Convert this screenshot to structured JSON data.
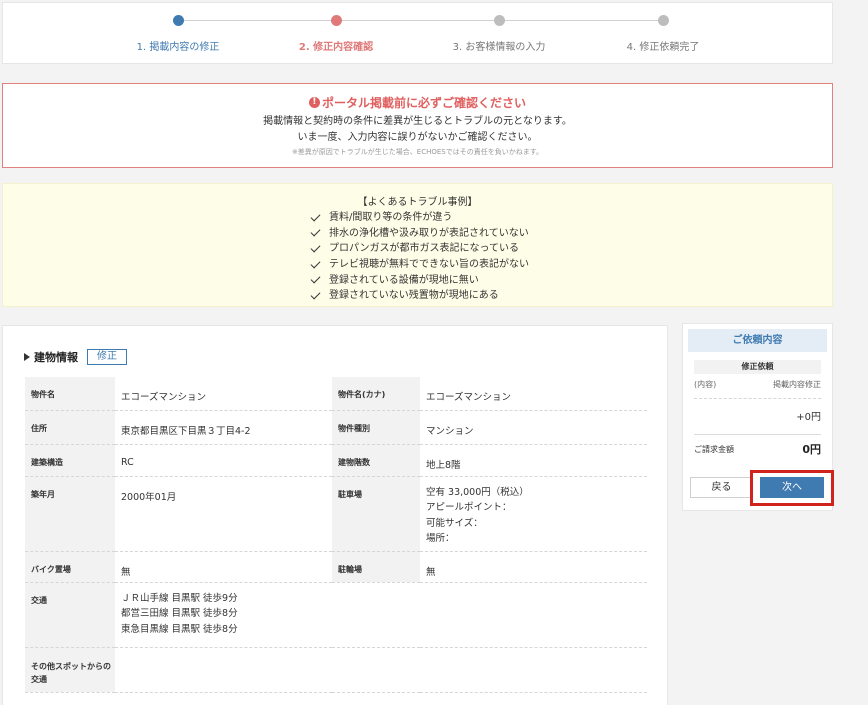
{
  "steps": [
    {
      "label": "1. 掲載内容の修正",
      "state": "done"
    },
    {
      "label": "2. 修正内容確認",
      "state": "active"
    },
    {
      "label": "3. お客様情報の入力",
      "state": "todo"
    },
    {
      "label": "4. 修正依頼完了",
      "state": "todo"
    }
  ],
  "alert": {
    "icon": "!",
    "title": "ポータル掲載前に必ずご確認ください",
    "line1": "掲載情報と契約時の条件に差異が生じるとトラブルの元となります。",
    "line2": "いま一度、入力内容に誤りがないかご確認ください。",
    "note": "※差異が原因でトラブルが生じた場合、ECHOESではその責任を負いかねます。"
  },
  "trouble": {
    "heading": "【よくあるトラブル事例】",
    "items": [
      "賃料/間取り等の条件が違う",
      "排水の浄化槽や汲み取りが表記されていない",
      "プロパンガスが都市ガス表記になっている",
      "テレビ視聴が無料でできない旨の表記がない",
      "登録されている設備が現地に無い",
      "登録されていない残置物が現地にある"
    ]
  },
  "building": {
    "title": "建物情報",
    "edit_label": "修正",
    "rows": {
      "name_label": "物件名",
      "name_value": "エコーズマンション",
      "kana_label": "物件名(カナ)",
      "kana_value": "エコーズマンション",
      "address_label": "住所",
      "address_value": "東京都目黒区下目黒３丁目4-2",
      "type_label": "物件種別",
      "type_value": "マンション",
      "structure_label": "建築構造",
      "structure_value": "RC",
      "floors_label": "建物階数",
      "floors_value": "地上8階",
      "built_label": "築年月",
      "built_value": "2000年01月",
      "parking_label": "駐車場",
      "parking_lines": [
        "空有 33,000円（税込）",
        "アピールポイント：",
        "可能サイズ：",
        "場所："
      ],
      "bike_label": "バイク置場",
      "bike_value": "無",
      "bicycle_label": "駐輪場",
      "bicycle_value": "無",
      "transport_label": "交通",
      "transport_lines": [
        "ＪＲ山手線 目黒駅 徒歩9分",
        "都営三田線 目黒駅 徒歩8分",
        "東急目黒線 目黒駅 徒歩8分"
      ],
      "other_label": "その他スポットからの交通",
      "other_value": ""
    }
  },
  "side": {
    "title": "ご依頼内容",
    "sub_title": "修正依頼",
    "content_label": "(内容)",
    "content_value": "掲載内容修正",
    "amount": "+0円",
    "total_label": "ご請求金額",
    "total_value": "0円",
    "back_label": "戻る",
    "next_label": "次へ"
  },
  "colors": {
    "accent": "#3f7ab0",
    "active_step": "#e07a7a",
    "alert": "#e06060",
    "highlight": "#d0231c"
  }
}
